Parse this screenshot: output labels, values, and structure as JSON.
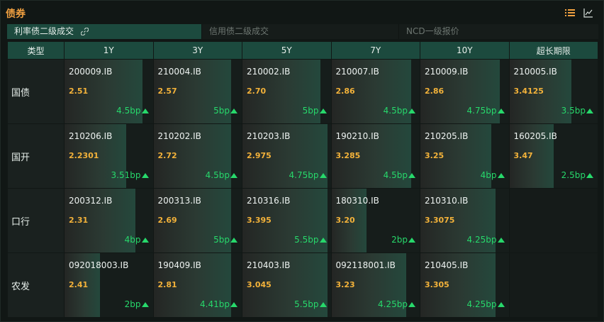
{
  "header": {
    "title": "债券"
  },
  "tabs": [
    {
      "label": "利率债二级成交",
      "active": true
    },
    {
      "label": "信用债二级成交",
      "active": false
    },
    {
      "label": "NCD一级报价",
      "active": false
    }
  ],
  "columns": [
    "类型",
    "1Y",
    "3Y",
    "5Y",
    "7Y",
    "10Y",
    "超长期限"
  ],
  "rows": [
    {
      "type": "国债",
      "cells": [
        {
          "code": "200009.IB",
          "yield": "2.51",
          "change": "4.5bp",
          "level": 0.88
        },
        {
          "code": "210004.IB",
          "yield": "2.57",
          "change": "5bp",
          "level": 0.88
        },
        {
          "code": "210002.IB",
          "yield": "2.70",
          "change": "5bp",
          "level": 0.88
        },
        {
          "code": "210007.IB",
          "yield": "2.86",
          "change": "4.5bp",
          "level": 0.9
        },
        {
          "code": "210009.IB",
          "yield": "2.86",
          "change": "4.75bp",
          "level": 0.9
        },
        {
          "code": "210005.IB",
          "yield": "3.4125",
          "change": "3.5bp",
          "level": 0.7
        }
      ]
    },
    {
      "type": "国开",
      "cells": [
        {
          "code": "210206.IB",
          "yield": "2.2301",
          "change": "3.51bp",
          "level": 0.7
        },
        {
          "code": "210202.IB",
          "yield": "2.72",
          "change": "4.5bp",
          "level": 0.88
        },
        {
          "code": "210203.IB",
          "yield": "2.975",
          "change": "4.75bp",
          "level": 0.96
        },
        {
          "code": "190210.IB",
          "yield": "3.285",
          "change": "4.5bp",
          "level": 0.9
        },
        {
          "code": "210205.IB",
          "yield": "3.25",
          "change": "4bp",
          "level": 0.8
        },
        {
          "code": "160205.IB",
          "yield": "3.47",
          "change": "2.5bp",
          "level": 0.5
        }
      ]
    },
    {
      "type": "口行",
      "cells": [
        {
          "code": "200312.IB",
          "yield": "2.31",
          "change": "4bp",
          "level": 0.8
        },
        {
          "code": "200313.IB",
          "yield": "2.69",
          "change": "5bp",
          "level": 0.88
        },
        {
          "code": "210316.IB",
          "yield": "3.395",
          "change": "5.5bp",
          "level": 0.96
        },
        {
          "code": "180310.IB",
          "yield": "3.20",
          "change": "2bp",
          "level": 0.4
        },
        {
          "code": "210310.IB",
          "yield": "3.3075",
          "change": "4.25bp",
          "level": 0.85
        },
        null
      ]
    },
    {
      "type": "农发",
      "cells": [
        {
          "code": "092018003.IB",
          "yield": "2.41",
          "change": "2bp",
          "level": 0.4
        },
        {
          "code": "190409.IB",
          "yield": "2.81",
          "change": "4.41bp",
          "level": 0.88
        },
        {
          "code": "210403.IB",
          "yield": "3.045",
          "change": "5.5bp",
          "level": 0.96
        },
        {
          "code": "092118001.IB",
          "yield": "3.23",
          "change": "4.25bp",
          "level": 0.85
        },
        {
          "code": "210405.IB",
          "yield": "3.305",
          "change": "4.25bp",
          "level": 0.85
        },
        null
      ]
    }
  ],
  "colors": {
    "accent": "#f0a040",
    "yield": "#f3b23a",
    "up": "#27d86b",
    "header_bg": "#1c4a3e"
  },
  "icons": {
    "list": "list-icon",
    "chart": "line-chart-icon",
    "link": "link-icon",
    "up": "up-arrow-icon"
  }
}
